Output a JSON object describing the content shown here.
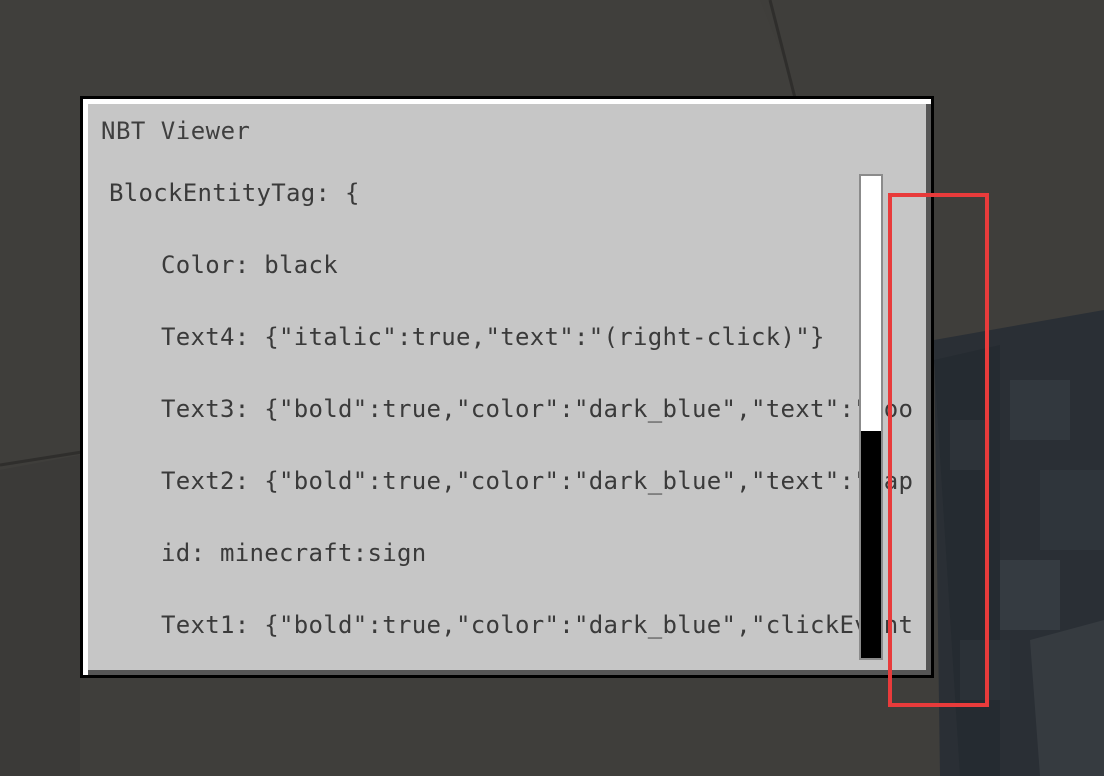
{
  "window": {
    "title": "NBT Viewer"
  },
  "nbt": {
    "lines": [
      "BlockEntityTag: {",
      "Color: black",
      "Text4: {\"italic\":true,\"text\":\"(right-click)\"}",
      "Text3: {\"bold\":true,\"color\":\"dark_blue\",\"text\":\"Poo",
      "Text2: {\"bold\":true,\"color\":\"dark_blue\",\"text\":\"Map",
      "id: minecraft:sign",
      "Text1: {\"bold\":true,\"color\":\"dark_blue\",\"clickEvent"
    ]
  },
  "scroll": {
    "position_fraction": 0.0,
    "visible_fraction": 0.53
  },
  "colors": {
    "panel": "#c6c6c6",
    "text": "#3a3a3a",
    "highlight": "#e83b3b"
  }
}
